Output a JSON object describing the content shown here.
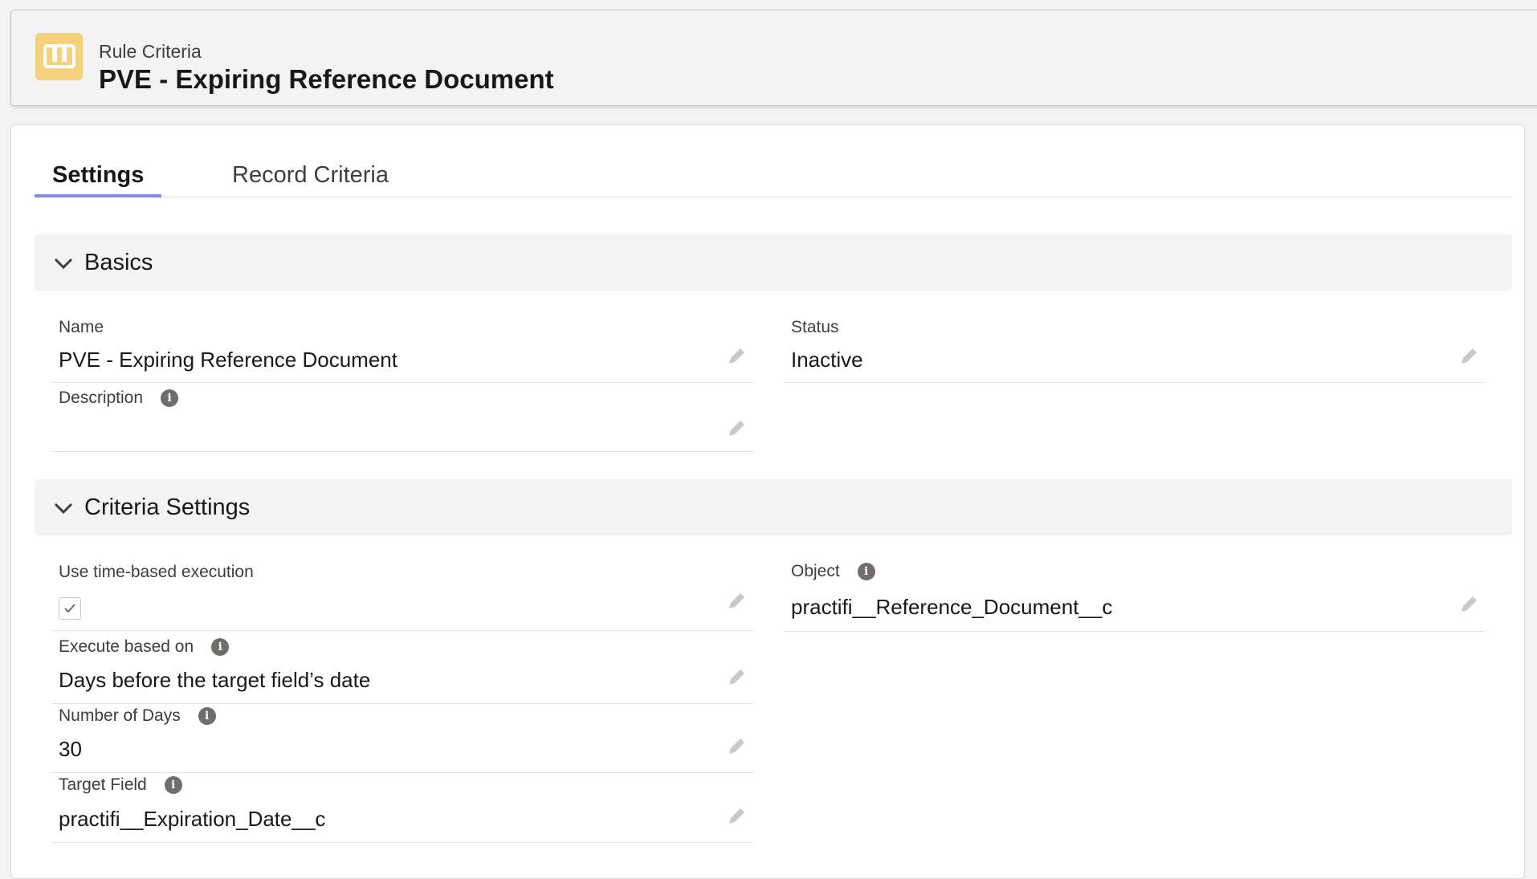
{
  "header": {
    "eyebrow": "Rule Criteria",
    "title": "PVE - Expiring Reference Document",
    "icon": "book-icon",
    "icon_color": "#f4d17a"
  },
  "tabs": [
    {
      "label": "Settings",
      "active": true
    },
    {
      "label": "Record Criteria",
      "active": false
    }
  ],
  "sections": {
    "basics": {
      "title": "Basics",
      "fields": {
        "name": {
          "label": "Name",
          "value": "PVE - Expiring Reference Document"
        },
        "status": {
          "label": "Status",
          "value": "Inactive"
        },
        "description": {
          "label": "Description",
          "value": ""
        }
      }
    },
    "criteria": {
      "title": "Criteria Settings",
      "fields": {
        "time_based": {
          "label": "Use time-based execution",
          "checked": true
        },
        "object": {
          "label": "Object",
          "value": "practifi__Reference_Document__c"
        },
        "execute_based_on": {
          "label": "Execute based on",
          "value": "Days before the target field’s date"
        },
        "number_of_days": {
          "label": "Number of Days",
          "value": "30"
        },
        "target_field": {
          "label": "Target Field",
          "value": "practifi__Expiration_Date__c"
        }
      }
    }
  },
  "colors": {
    "active_tab_underline": "#7f8de1",
    "section_bg": "#f3f3f3",
    "info_icon": "#706e6b"
  }
}
